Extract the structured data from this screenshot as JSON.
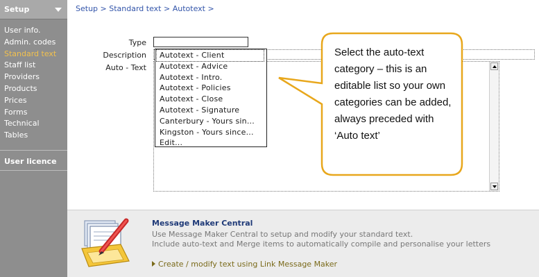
{
  "sidebar": {
    "title": "Setup",
    "items": [
      {
        "label": "User info."
      },
      {
        "label": "Admin. codes"
      },
      {
        "label": "Standard text",
        "active": true
      },
      {
        "label": "Staff list"
      },
      {
        "label": "Providers"
      },
      {
        "label": "Products"
      },
      {
        "label": "Prices"
      },
      {
        "label": "Forms"
      },
      {
        "label": "Technical"
      },
      {
        "label": "Tables"
      }
    ],
    "licence": "User licence"
  },
  "breadcrumb": [
    "Setup",
    "Standard text",
    "Autotext"
  ],
  "breadcrumb_sep": " > ",
  "breadcrumb_trailing": " >",
  "form": {
    "type_label": "Type",
    "type_value": "",
    "description_label": "Description",
    "autotext_label": "Auto - Text"
  },
  "dropdown": {
    "options": [
      "Autotext - Client",
      "Autotext - Advice",
      "Autotext - Intro.",
      "Autotext - Policies",
      "Autotext - Close",
      "Autotext - Signature",
      "Canterbury - Yours sin...",
      "Kingston - Yours since...",
      "Edit..."
    ],
    "selected_index": 0
  },
  "callout": {
    "text": "Select the auto-text category – this is an editable list so your own categories can be added, always preceded with ‘Auto text’",
    "border_color": "#e8a71c"
  },
  "message_maker": {
    "title": "Message Maker Central",
    "line1": "Use Message Maker Central to setup and modify your standard text.",
    "line2": "Include auto-text and Merge items to automatically compile and personalise your letters",
    "link": "Create / modify  text using Link Message Maker"
  },
  "colors": {
    "sidebar_bg": "#8e8e8e",
    "active_item": "#f2c14e",
    "breadcrumb": "#3355aa",
    "callout_border": "#e8a71c"
  }
}
